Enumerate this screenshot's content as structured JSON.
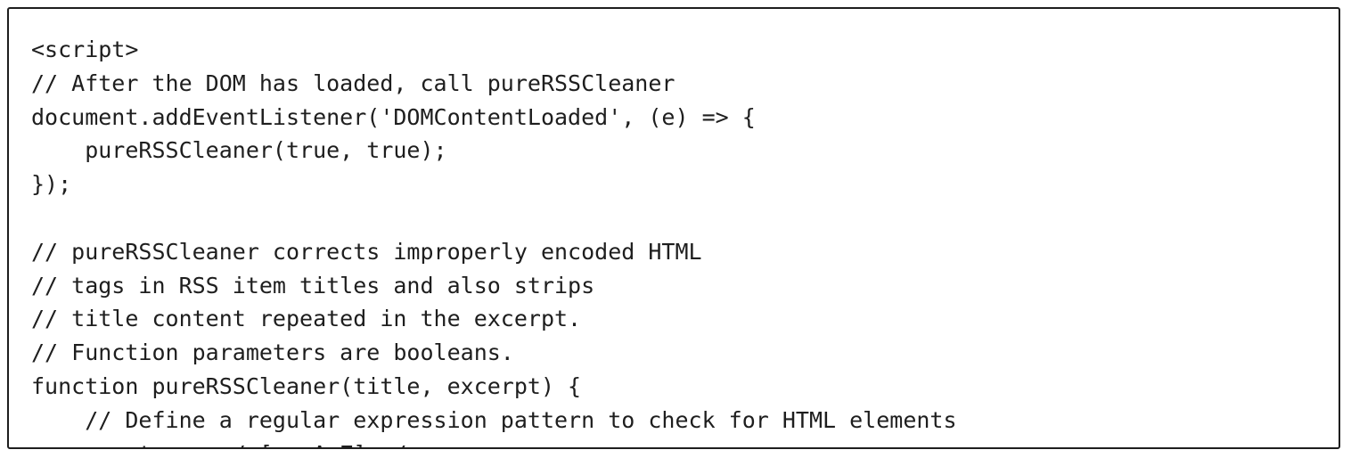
{
  "code_block": {
    "lines": [
      "<script>",
      "// After the DOM has loaded, call pureRSSCleaner",
      "document.addEventListener('DOMContentLoaded', (e) => {",
      "    pureRSSCleaner(true, true);",
      "});",
      "",
      "// pureRSSCleaner corrects improperly encoded HTML",
      "// tags in RSS item titles and also strips",
      "// title content repeated in the excerpt.",
      "// Function parameters are booleans.",
      "function pureRSSCleaner(title, excerpt) {",
      "    // Define a regular expression pattern to check for HTML elements",
      "    const re = /<[a-zA-Z]+>/;"
    ]
  }
}
